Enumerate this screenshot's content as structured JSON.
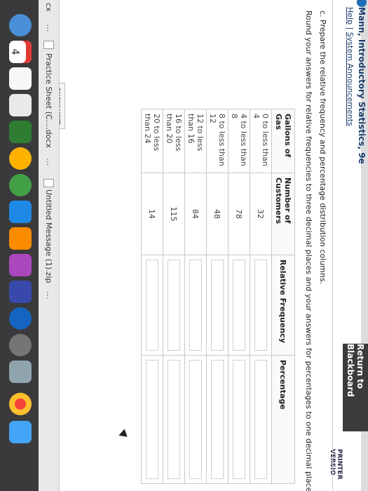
{
  "header": {
    "return_label": "Return to Blackboard",
    "book_title": "Mann, Introductory Statistics, 9e",
    "help_label": "Help",
    "separator": "|",
    "announcements_label": "System Announcements",
    "printer_label": "PRINTER VERSIO"
  },
  "question": {
    "title": "c. Prepare the relative frequency and percentage distribution columns.",
    "instruction": "Round your answers for relative frequencies to three decimal places and your answers for percentages to one decimal place."
  },
  "table": {
    "headers": [
      "Gallons of Gas",
      "Number of Customers",
      "Relative Frequency",
      "Percentage"
    ],
    "rows": [
      {
        "class": "0 to less than 4",
        "count": "32"
      },
      {
        "class": "4 to less than 8",
        "count": "78"
      },
      {
        "class": "8 to less than 12",
        "count": "48"
      },
      {
        "class": "12 to less than 16",
        "count": "84"
      },
      {
        "class": "16 to less than 20",
        "count": "115"
      },
      {
        "class": "20 to less than 24",
        "count": "14"
      }
    ]
  },
  "hint": {
    "label": "SHOW HINT"
  },
  "downloads": {
    "left_label": "cx",
    "left_more": "...",
    "item1": "Practice Sheet (C....docx",
    "item1_more": "...",
    "item2": "Untitled Message (1).zip",
    "item2_more": "..."
  },
  "dock": {
    "calendar_day": "4"
  },
  "colors": {
    "title_blue": "#1a3c6e",
    "return_bg": "#3b3b3b",
    "dock_bg": "#3a3a3c"
  }
}
